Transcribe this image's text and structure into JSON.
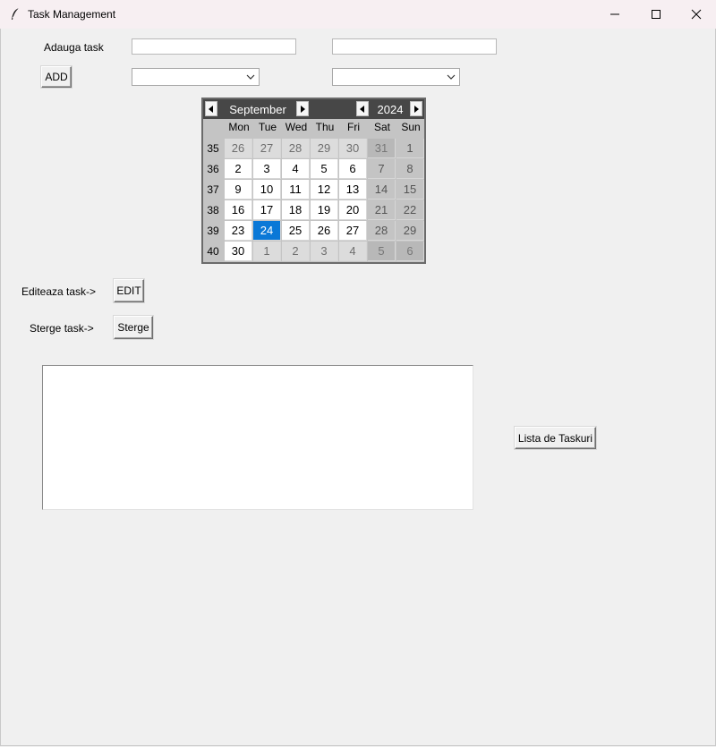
{
  "window": {
    "title": "Task Management",
    "icon": "feather-icon",
    "controls": [
      "minimize-icon",
      "maximize-icon",
      "close-icon"
    ]
  },
  "form": {
    "add_task_label": "Adauga task",
    "task_name_value": "",
    "task_detail_value": "",
    "add_button": "ADD",
    "combo_1_value": "",
    "combo_2_value": "",
    "edit_label": "Editeaza task->",
    "edit_button": "EDIT",
    "delete_label": "Sterge task->",
    "delete_button": "Sterge",
    "list_button": "Lista de Taskuri"
  },
  "calendar": {
    "month": "September",
    "year": "2024",
    "selected_day": "24",
    "weekday_headers": [
      "Mon",
      "Tue",
      "Wed",
      "Thu",
      "Fri",
      "Sat",
      "Sun"
    ],
    "weeks": [
      {
        "num": "35",
        "days": [
          "26",
          "27",
          "28",
          "29",
          "30",
          "31",
          "1"
        ]
      },
      {
        "num": "36",
        "days": [
          "2",
          "3",
          "4",
          "5",
          "6",
          "7",
          "8"
        ]
      },
      {
        "num": "37",
        "days": [
          "9",
          "10",
          "11",
          "12",
          "13",
          "14",
          "15"
        ]
      },
      {
        "num": "38",
        "days": [
          "16",
          "17",
          "18",
          "19",
          "20",
          "21",
          "22"
        ]
      },
      {
        "num": "39",
        "days": [
          "23",
          "24",
          "25",
          "26",
          "27",
          "28",
          "29"
        ]
      },
      {
        "num": "40",
        "days": [
          "30",
          "1",
          "2",
          "3",
          "4",
          "5",
          "6"
        ]
      }
    ],
    "colors": {
      "header_bg": "#474747",
      "selected_bg": "#0a78d7",
      "weekend_bg": "#c4c4c4",
      "other_month_fg": "#6e6e6e"
    }
  },
  "task_list": {
    "items": []
  }
}
